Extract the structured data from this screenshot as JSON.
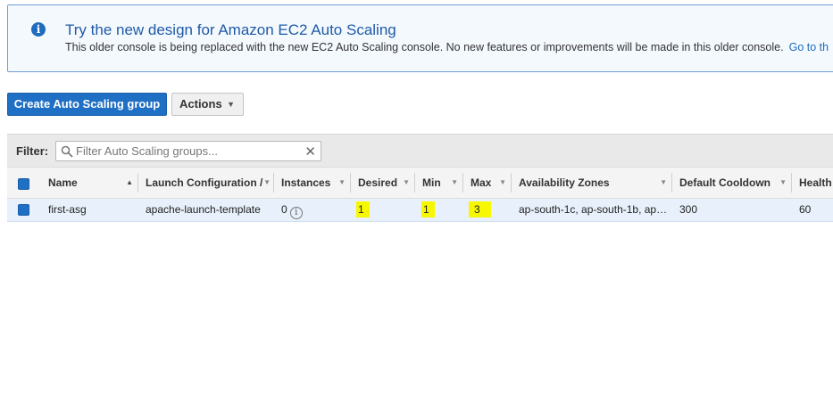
{
  "banner": {
    "title": "Try the new design for Amazon EC2 Auto Scaling",
    "text": "This older console is being replaced with the new EC2 Auto Scaling console. No new features or improvements will be made in this older console.",
    "link": "Go to th"
  },
  "toolbar": {
    "create_label": "Create Auto Scaling group",
    "actions_label": "Actions"
  },
  "filter": {
    "label": "Filter:",
    "placeholder": "Filter Auto Scaling groups..."
  },
  "table": {
    "columns": [
      "Name",
      "Launch Configuration /",
      "Instances",
      "Desired",
      "Min",
      "Max",
      "Availability Zones",
      "Default Cooldown",
      "Health"
    ],
    "rows": [
      {
        "name": "first-asg",
        "launch_config": "apache-launch-template",
        "instances": "0",
        "desired": "1",
        "min": "1",
        "max": "3",
        "zones": "ap-south-1c, ap-south-1b, ap…",
        "cooldown": "300",
        "health": "60"
      }
    ]
  },
  "colors": {
    "accent": "#1f6fc5",
    "highlight": "#f7f700",
    "banner_border": "#6f9fd8"
  }
}
